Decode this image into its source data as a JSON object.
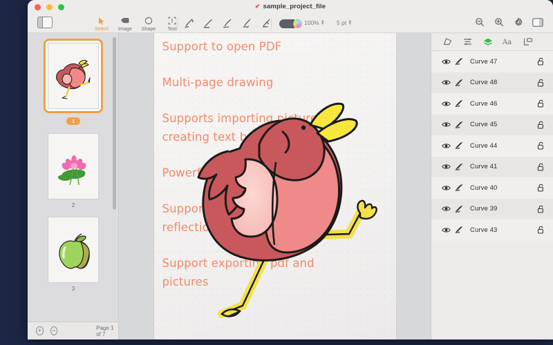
{
  "window": {
    "title": "sample_project_file",
    "title_mark": "edit-mark-icon",
    "traffic_lights": [
      "close",
      "minimize",
      "maximize"
    ]
  },
  "toolbar": {
    "sidebar_toggle": "sidebar-toggle-icon",
    "tools": [
      {
        "label": "Select",
        "icon": "cursor-arrow-icon",
        "active": true
      },
      {
        "label": "Image",
        "icon": "image-icon",
        "active": false
      },
      {
        "label": "Shape",
        "icon": "circle-shape-icon",
        "active": false
      },
      {
        "label": "Text",
        "icon": "text-box-icon",
        "active": false
      }
    ],
    "pens": [
      "marker-pen-icon",
      "straight-line-icon",
      "pencil-icon",
      "brush-pen-icon",
      "highlighter-icon"
    ],
    "color_swatch": "dark-gray-swatch",
    "color_wheel": "rainbow-color-wheel-icon",
    "opacity_value": "100%",
    "stroke_size_value": "5 pt",
    "right_icons": [
      "zoom-out-icon",
      "zoom-in-icon",
      "settings-gear-icon",
      "right-panel-toggle-icon"
    ]
  },
  "pages_panel": {
    "pages": [
      {
        "number": "1",
        "thumbnail": "bird-drawing",
        "selected": true
      },
      {
        "number": "2",
        "thumbnail": "lotus-flower-drawing",
        "selected": false
      },
      {
        "number": "3",
        "thumbnail": "green-apple-drawing",
        "selected": false
      }
    ],
    "footer": {
      "add_page_label": "+",
      "remove_page_label": "−",
      "page_counter": "Page 1 of 7"
    }
  },
  "canvas": {
    "paragraphs": [
      [
        "Support to open PDF"
      ],
      [
        "Multi-page drawing"
      ],
      [
        "Supports importing pictures,",
        "creating text box, shapes"
      ],
      [
        "Powerful line tool"
      ],
      [
        "Support setting shadow,",
        "reflection and other effects"
      ],
      [
        "Support exporting pdf and",
        "pictures"
      ]
    ],
    "text_color": "#f08a6a",
    "artwork": "walking-bird-illustration"
  },
  "layers_panel": {
    "tabs": [
      {
        "icon": "transform-shape-icon",
        "active": false
      },
      {
        "icon": "align-icon",
        "active": false
      },
      {
        "icon": "layers-stack-icon",
        "active": true
      },
      {
        "icon": "typography-icon",
        "active": false
      },
      {
        "icon": "arrange-icon",
        "active": false
      }
    ],
    "active_tab_color": "#2fc14f",
    "layers": [
      {
        "name": "Curve 47",
        "visible": true,
        "locked": false
      },
      {
        "name": "Curve 48",
        "visible": true,
        "locked": false
      },
      {
        "name": "Curve 46",
        "visible": true,
        "locked": false
      },
      {
        "name": "Curve 45",
        "visible": true,
        "locked": false
      },
      {
        "name": "Curve 44",
        "visible": true,
        "locked": false
      },
      {
        "name": "Curve 41",
        "visible": true,
        "locked": false
      },
      {
        "name": "Curve 40",
        "visible": true,
        "locked": false
      },
      {
        "name": "Curve 39",
        "visible": true,
        "locked": false
      },
      {
        "name": "Curve 43",
        "visible": true,
        "locked": false
      }
    ]
  }
}
